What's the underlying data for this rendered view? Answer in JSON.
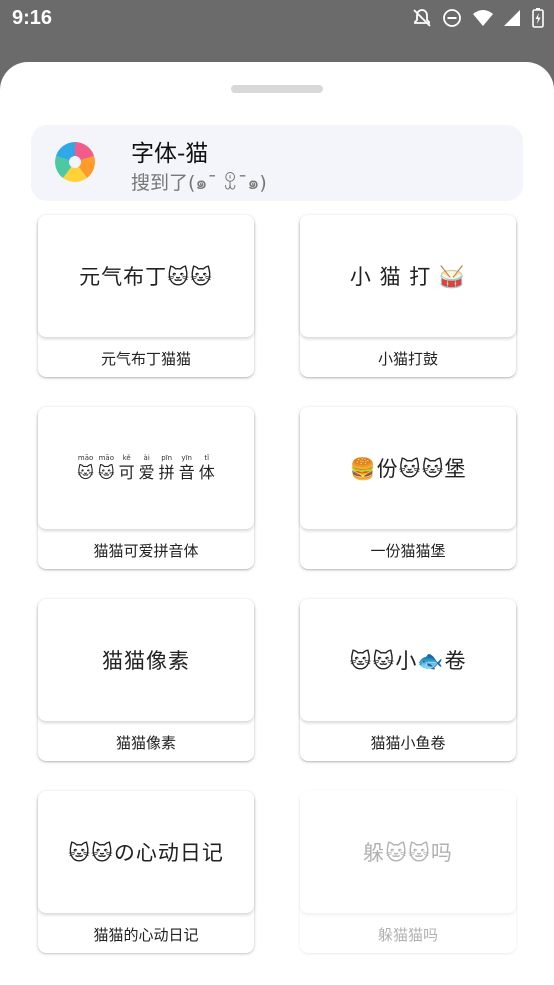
{
  "status_bar": {
    "time": "9:16",
    "icons": [
      "notifications-off-icon",
      "do-not-disturb-icon",
      "wifi-icon",
      "signal-icon",
      "battery-icon"
    ]
  },
  "sheet": {
    "header": {
      "title": "字体-猫",
      "subtitle": "搜到了(๑¯ ꀾ¯๑)",
      "logo_icon": "app-logo-icon"
    },
    "fonts": [
      {
        "preview": "元气布丁🐱🐱",
        "name": "元气布丁猫猫"
      },
      {
        "preview": "小 猫 打 🥁",
        "name": "小猫打鼓"
      },
      {
        "preview_pinyin": [
          {
            "py": "māo",
            "hz": "🐱"
          },
          {
            "py": "māo",
            "hz": "🐱"
          },
          {
            "py": "kě",
            "hz": "可"
          },
          {
            "py": "ài",
            "hz": "爱"
          },
          {
            "py": "pīn",
            "hz": "拼"
          },
          {
            "py": "yīn",
            "hz": "音"
          },
          {
            "py": "tǐ",
            "hz": "体"
          }
        ],
        "name": "猫猫可爱拼音体"
      },
      {
        "preview": "🍔份🐱🐱堡",
        "name": "一份猫猫堡"
      },
      {
        "preview": "猫猫像素",
        "name": "猫猫像素"
      },
      {
        "preview": "🐱🐱小🐟卷",
        "name": "猫猫小鱼卷"
      },
      {
        "preview": "🐱🐱の心动日记",
        "name": "猫猫的心动日记"
      },
      {
        "preview": "躲🐱🐱吗",
        "name": "躲猫猫吗"
      }
    ]
  },
  "colors": {
    "scrim": "#6b6b6b",
    "header_bg": "#f4f5fb",
    "handle": "#d8d8d8"
  }
}
